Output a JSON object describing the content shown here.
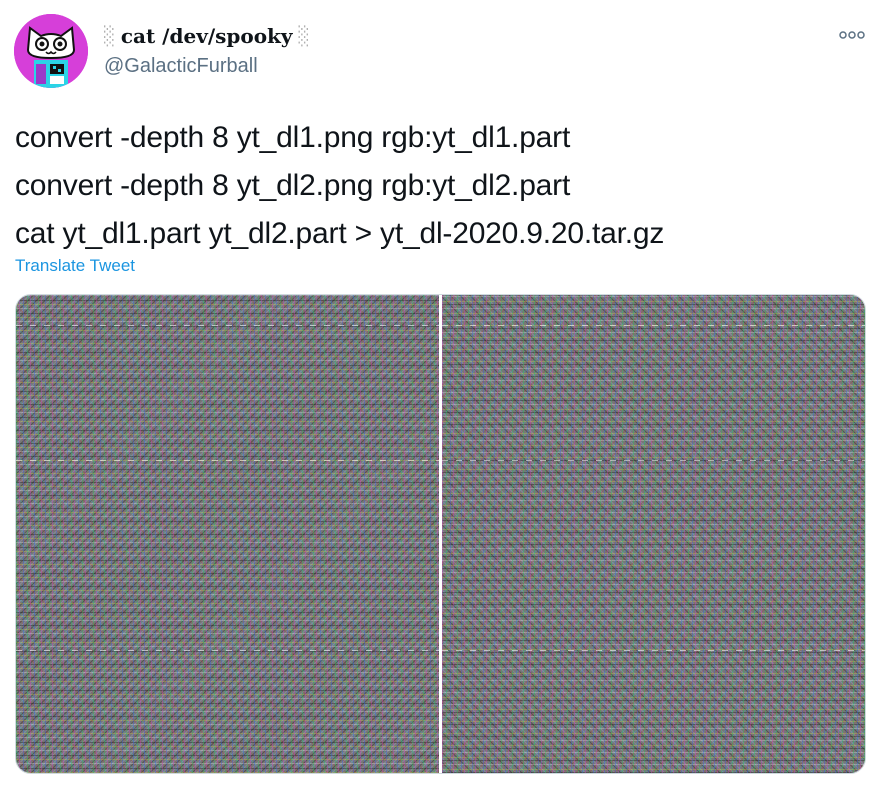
{
  "author": {
    "display_name": "cat /dev/spooky",
    "name_decoration_left": "░",
    "name_decoration_right": "░",
    "handle": "@GalacticFurball",
    "avatar_icon": "cat-face-avatar-icon"
  },
  "tweet": {
    "lines": [
      "convert -depth 8 yt_dl1.png rgb:yt_dl1.part",
      "convert -depth 8 yt_dl2.png rgb:yt_dl2.part",
      "cat yt_dl1.part yt_dl2.part > yt_dl-2020.9.20.tar.gz"
    ],
    "translate_label": "Translate Tweet"
  },
  "media": {
    "images": [
      {
        "name": "yt_dl1-noise-image"
      },
      {
        "name": "yt_dl2-noise-image"
      }
    ]
  },
  "colors": {
    "link": "#1b95e0",
    "secondary_text": "#5b7083",
    "primary_text": "#0f1419",
    "avatar_bg": "#d63fd9"
  },
  "icons": {
    "more": "more-options-icon"
  }
}
